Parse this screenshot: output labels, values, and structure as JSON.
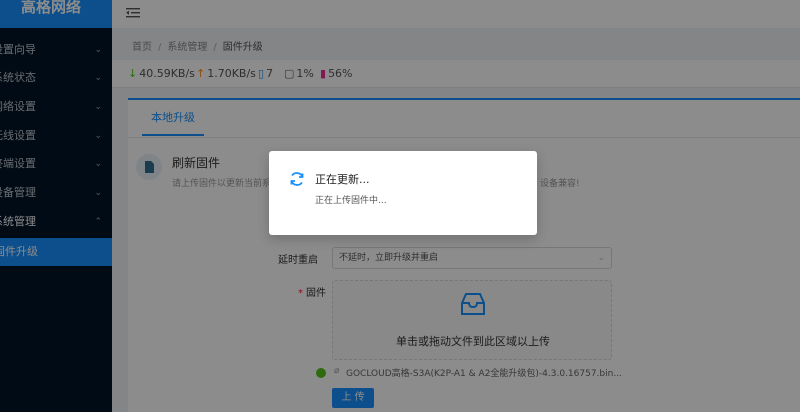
{
  "brand": "高格网络",
  "sidebar": {
    "items": [
      {
        "label": "设置向导"
      },
      {
        "label": "系统状态"
      },
      {
        "label": "网络设置"
      },
      {
        "label": "无线设置"
      },
      {
        "label": "终端设置"
      },
      {
        "label": "设备管理"
      },
      {
        "label": "系统管理"
      }
    ],
    "active_sub": "固件升级"
  },
  "breadcrumb": {
    "home": "首页",
    "section": "系统管理",
    "current": "固件升级"
  },
  "stats": {
    "download": "40.59KB/s",
    "upload": "1.70KB/s",
    "devices": "7",
    "cpu": "1%",
    "memory": "56%"
  },
  "tabs": [
    "本地升级"
  ],
  "section": {
    "title": "刷新固件",
    "desc_left": "请上传固件以更新当前系",
    "desc_right": "设备兼容!"
  },
  "form": {
    "delay_label": "延时重启",
    "delay_value": "不延时，立即升级并重启",
    "firmware_label": "固件",
    "dropzone_text": "单击或拖动文件到此区域以上传",
    "file_name": "GOCLOUD高格-S3A(K2P-A1 & A2全能升级包)-4.3.0.16757.bin...",
    "upload_button": "上 传"
  },
  "modal": {
    "title": "正在更新...",
    "message": "正在上传固件中..."
  },
  "colors": {
    "accent": "#1890ff",
    "sidebar": "#001529",
    "success": "#52c41a"
  }
}
